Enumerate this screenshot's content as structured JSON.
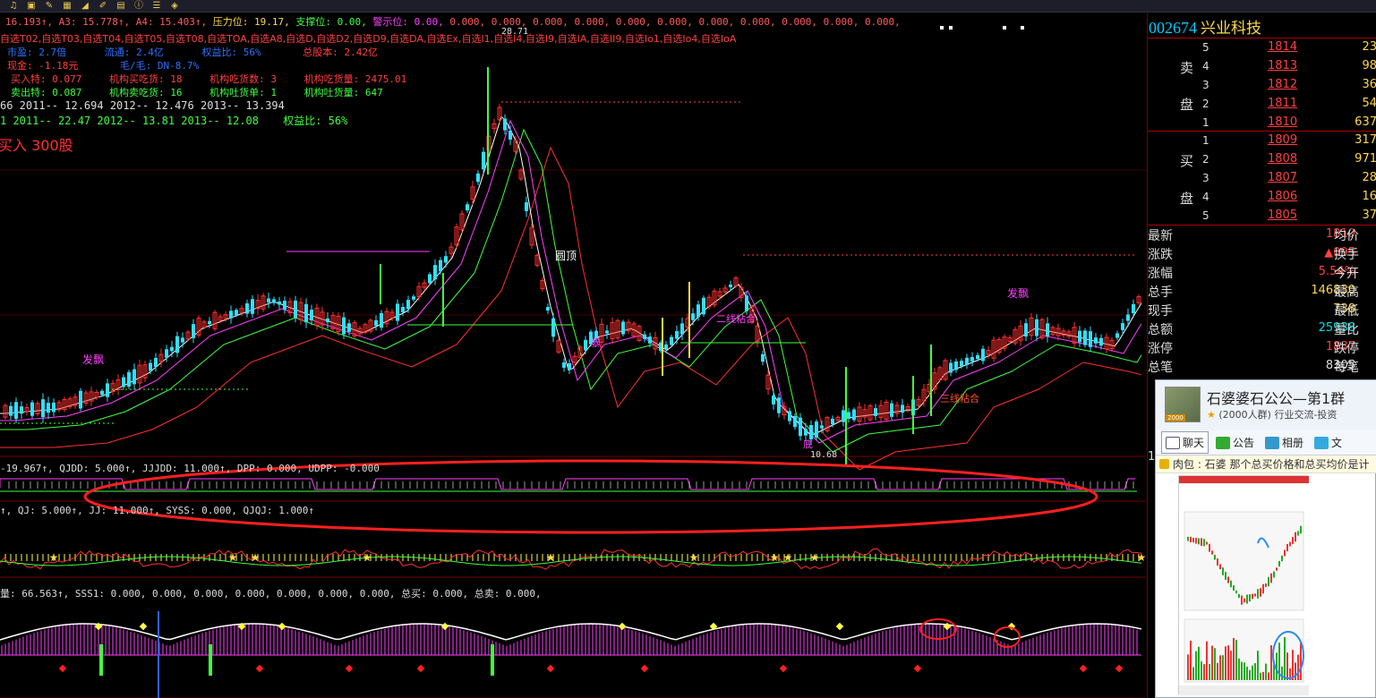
{
  "toolbar": {
    "icons": [
      "bell-icon",
      "mark-icon",
      "edit-icon",
      "grid-icon",
      "ruler-icon",
      "draw-icon",
      "doc-icon",
      "info-icon",
      "layers-icon",
      "help-icon"
    ]
  },
  "header_lines": {
    "line1": {
      "prefix": "16.193↑, A3: 15.778↑, A4: 15.403↑,",
      "pressure": "压力位: 19.17,",
      "support": "支撑位: 0.00,",
      "warn": "警示位: 0.00,",
      "tail": "0.000, 0.000, 0.000, 0.000, 0.000, 0.000, 0.000, 0.000, 0.000, 0.000, 0.000,"
    },
    "line2": "自选T02,自选T03,自选T04,自选T05,自选T08,自选TOA,自选A8,自选D,自选D2,自选D9,自选DA,自选Ex,自选I1,自选I4,自选I9,自选IA,自选II9,自选Io1,自选Io4,自选IoA",
    "line3": {
      "pe": "市盈: 2.7倍",
      "float": "流通: 2.4亿",
      "ratio": "权益比: 56%",
      "total": "总股本: 2.42亿"
    },
    "line4": {
      "cash": "现金: -1.18元",
      "margin": "毛/毛: DN-8.7%"
    },
    "line5": {
      "a": "买入特: 0.077",
      "b": "机构买吃货: 18",
      "c": "机构吃货数: 3",
      "d": "机构吃货量: 2475.01"
    },
    "line6": {
      "a": "卖出特: 0.087",
      "b": "机构卖吃货: 16",
      "c": "机构吐货单: 1",
      "d": "机构吐货量: 647"
    },
    "line7": "66   2011-- 12.694   2012-- 12.476   2013-- 13.394",
    "line8": {
      "a": "1   2011-- 22.47   2012-- 13.81   2013-- 12.08",
      "b": "权益比: 56%"
    },
    "buy": "买入  300股"
  },
  "annotations": {
    "peak": "28.71",
    "low": "10.68",
    "round_top": "圆顶",
    "fa_piao_1": "发飘",
    "fa_piao_2": "发飘",
    "fa_piao_3": "发飘",
    "er_xian": "二线粘合",
    "san_xian": "三线粘合",
    "bao": "暴",
    "di": "底"
  },
  "sub1": "-19.967↑, QJDD: 5.000↑, JJJDD: 11.000↑, DPP: 0.000, UDPP: -0.000",
  "sub2": "↑, QJ: 5.000↑, JJ: 11.000↑, SYSS: 0.000, QJQJ: 1.000↑",
  "sub3": "量: 66.563↑, SSS1: 0.000, 0.000, 0.000, 0.000, 0.000, 0.000, 0.000, 总买: 0.000, 总卖: 0.000,",
  "stock": {
    "code": "002674",
    "name": "兴业科技"
  },
  "orderbook": {
    "sell_label_1": "卖",
    "sell_label_2": "盘",
    "buy_label_1": "买",
    "buy_label_2": "盘",
    "asks": [
      {
        "level": "5",
        "price": "1814",
        "vol": "23"
      },
      {
        "level": "4",
        "price": "1813",
        "vol": "98"
      },
      {
        "level": "3",
        "price": "1812",
        "vol": "36"
      },
      {
        "level": "2",
        "price": "1811",
        "vol": "54"
      },
      {
        "level": "1",
        "price": "1810",
        "vol": "637"
      }
    ],
    "bids": [
      {
        "level": "1",
        "price": "1809",
        "vol": "317"
      },
      {
        "level": "2",
        "price": "1808",
        "vol": "971"
      },
      {
        "level": "3",
        "price": "1807",
        "vol": "28"
      },
      {
        "level": "4",
        "price": "1806",
        "vol": "16"
      },
      {
        "level": "5",
        "price": "1805",
        "vol": "37"
      }
    ]
  },
  "quote": [
    {
      "label": "最新",
      "value": "1810",
      "color": "#ff4040",
      "label2": "均价"
    },
    {
      "label": "涨跌",
      "value": "▲095",
      "color": "#ff4040",
      "label2": "换手"
    },
    {
      "label": "涨幅",
      "value": "5.54%",
      "color": "#ff4040",
      "label2": "今开"
    },
    {
      "label": "总手",
      "value": "146830",
      "color": "#ffd84a",
      "label2": "最高"
    },
    {
      "label": "现手",
      "value": "738",
      "color": "#ffd84a",
      "label2": "最低"
    },
    {
      "label": "总额",
      "value": "25938",
      "color": "#00e0e0",
      "label2": "量比"
    },
    {
      "label": "涨停",
      "value": "1887",
      "color": "#ff4040",
      "label2": "跌停"
    },
    {
      "label": "总笔",
      "value": "8305",
      "color": "#ddd",
      "label2": "每笔"
    }
  ],
  "chat": {
    "group_name": "石婆婆石公公—第1群",
    "group_meta": "(2000人群) 行业交流-投资",
    "avatar_badge": "2000",
    "tabs": [
      "聊天",
      "公告",
      "相册",
      "文"
    ],
    "notice": "肉包 :  石婆  那个总买价格和总买均价是计"
  },
  "colors": {
    "up": "#ff3030",
    "down": "#30e0ff",
    "ma5": "#ffffff",
    "ma10": "#ff40ff",
    "ma20": "#40ff40",
    "ma60": "#ff3030",
    "accent": "#ffd84a"
  }
}
